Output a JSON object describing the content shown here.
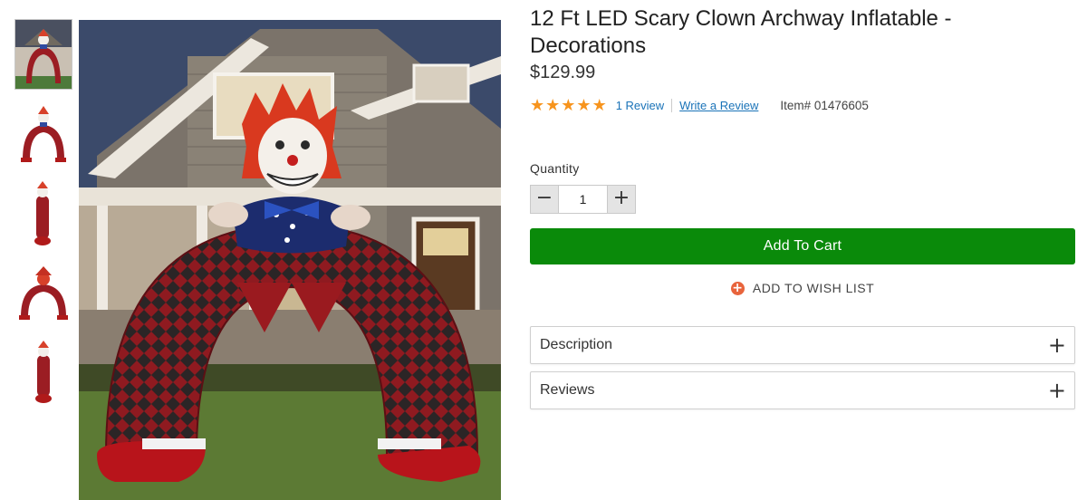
{
  "product": {
    "title": "12 Ft LED Scary Clown Archway Inflatable - Decorations",
    "price": "$129.99",
    "rating_stars": 5,
    "review_count_label": "1 Review",
    "write_review_label": "Write a Review",
    "item_number": "Item# 01476605"
  },
  "quantity": {
    "label": "Quantity",
    "value": "1",
    "decrement_symbol": "−",
    "increment_symbol": "+"
  },
  "actions": {
    "add_to_cart": "Add To Cart",
    "wishlist_icon": "+",
    "add_to_wishlist": "ADD TO WISH LIST"
  },
  "accordions": [
    {
      "label": "Description",
      "icon": "+"
    },
    {
      "label": "Reviews",
      "icon": "+"
    }
  ],
  "gallery": {
    "thumbnail_count": 5,
    "selected_index": 0
  },
  "colors": {
    "accent_green": "#0a8a0a",
    "star_orange": "#f7941d",
    "link_blue": "#1a73b8",
    "wishlist_orange": "#e8643c"
  }
}
